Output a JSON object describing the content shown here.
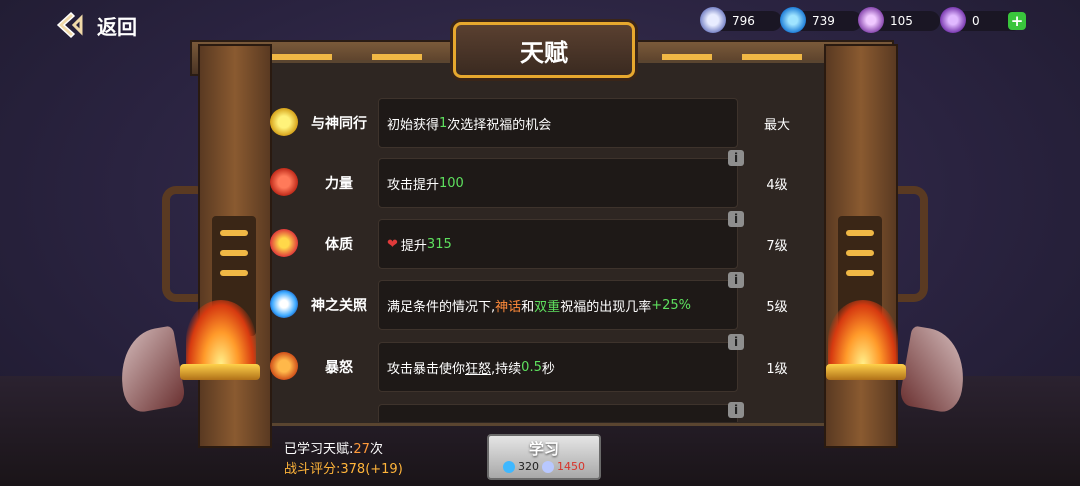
{
  "nav": {
    "back_label": "返回"
  },
  "resources": [
    {
      "icon": "silver-coin-icon",
      "value": "796",
      "color": "#b8c8ff"
    },
    {
      "icon": "blue-potion-icon",
      "value": "739",
      "color": "#3fb8ff"
    },
    {
      "icon": "purple-shell-locked-icon",
      "value": "105",
      "color": "#c07ad8"
    },
    {
      "icon": "purple-shell-icon",
      "value": "0",
      "color": "#a46ad0"
    }
  ],
  "title": "天赋",
  "talents": [
    {
      "icon": "angel-icon",
      "name": "与神同行",
      "desc": [
        "初始获得",
        "1",
        "次选择祝福的机会"
      ],
      "level": "最大",
      "info": false
    },
    {
      "icon": "muscle-icon",
      "name": "力量",
      "desc": [
        "攻击提升",
        "100"
      ],
      "level": "4级",
      "info": true
    },
    {
      "icon": "heart-arrow-icon",
      "name": "体质",
      "desc": [
        "提升",
        "315"
      ],
      "level": "7级",
      "info": true
    },
    {
      "icon": "star-ring-icon",
      "name": "神之关照",
      "desc": [
        "满足条件的情况下,",
        "神话",
        "和",
        "双重",
        "祝福的出现几率",
        "+25%"
      ],
      "level": "5级",
      "info": true
    },
    {
      "icon": "angry-face-icon",
      "name": "暴怒",
      "desc": [
        "攻击暴击使你",
        "狂怒",
        ",持续",
        "0.5",
        "秒"
      ],
      "level": "1级",
      "info": true
    }
  ],
  "info_symbol": "i",
  "stats": {
    "learned_label": "已学习天赋:",
    "learned_count": "27",
    "learned_unit": "次",
    "score_label": "战斗评分:378(+19)"
  },
  "learn_button": {
    "label": "学习",
    "cost_potion": "320",
    "cost_coin": "1450"
  },
  "colors": {
    "accent": "#e7a82e",
    "green": "#5ee05e",
    "orange": "#ff8a3a",
    "cost_red": "#d8332a"
  }
}
